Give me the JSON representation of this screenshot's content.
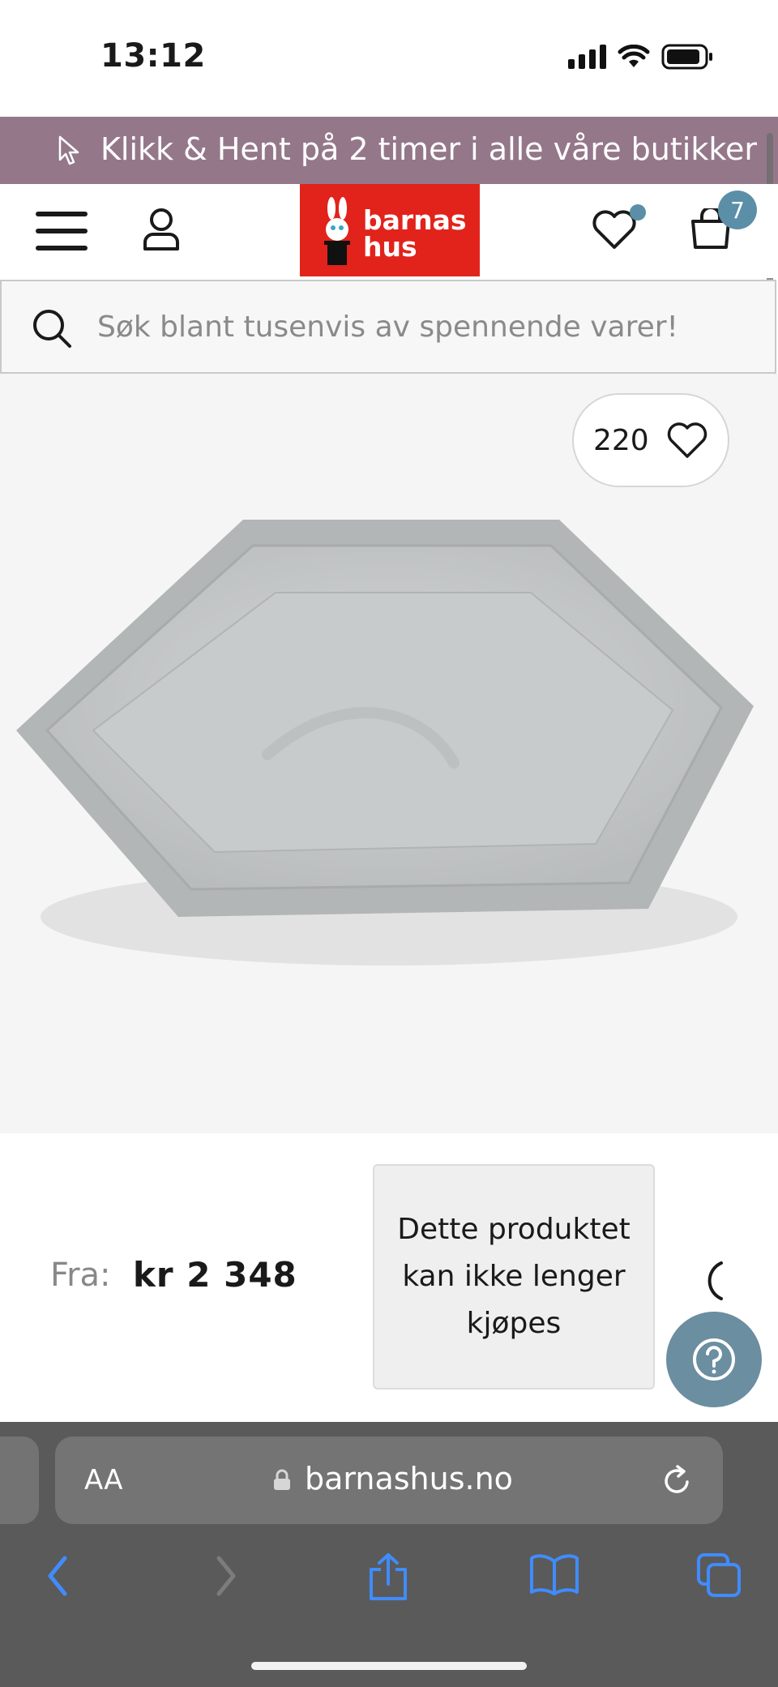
{
  "status_bar": {
    "time": "13:12"
  },
  "promo_banner": {
    "text": "Klikk & Hent på 2 timer i alle våre butikker"
  },
  "header": {
    "logo_line1": "barnas",
    "logo_line2": "hus",
    "cart_count": "7",
    "accent_color": "#5b8fa8",
    "brand_color": "#e1231b"
  },
  "search": {
    "placeholder": "Søk blant tusenvis av spennende varer!"
  },
  "product": {
    "like_count": "220",
    "price_label": "Fra:",
    "price": "kr 2 348",
    "unavailable_text": "Dette produktet kan ikke lenger kjøpes"
  },
  "browser": {
    "aa_label": "AA",
    "url": "barnashus.no"
  },
  "icons": [
    "menu-icon",
    "user-icon",
    "heart-icon",
    "bag-icon",
    "search-icon",
    "help-icon",
    "lock-icon",
    "reload-icon",
    "back-icon",
    "forward-icon",
    "share-icon",
    "bookmarks-icon",
    "tabs-icon"
  ]
}
